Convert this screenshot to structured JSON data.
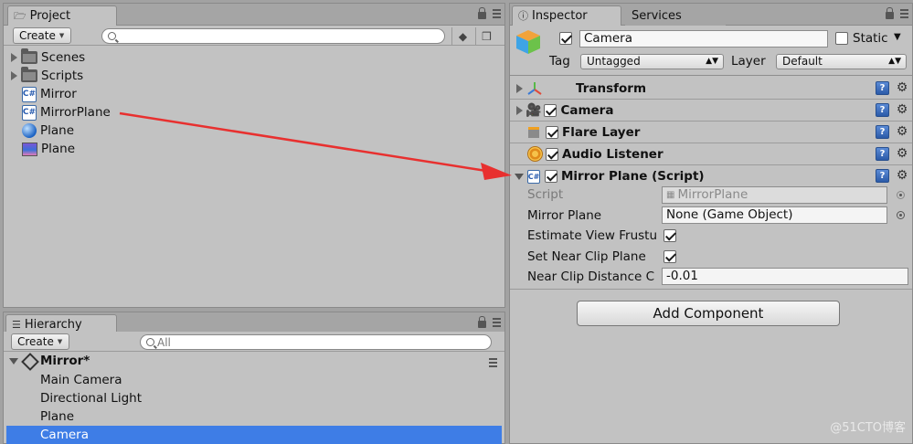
{
  "project": {
    "tab_label": "Project",
    "create_label": "Create",
    "search_placeholder": "",
    "items": [
      {
        "label": "Scenes",
        "type": "folder"
      },
      {
        "label": "Scripts",
        "type": "folder"
      },
      {
        "label": "Mirror",
        "type": "script"
      },
      {
        "label": "MirrorPlane",
        "type": "script"
      },
      {
        "label": "Plane",
        "type": "material"
      },
      {
        "label": "Plane",
        "type": "texture"
      }
    ]
  },
  "hierarchy": {
    "tab_label": "Hierarchy",
    "create_label": "Create",
    "search_placeholder": "All",
    "scene_name": "Mirror*",
    "items": [
      {
        "label": "Main Camera",
        "selected": false
      },
      {
        "label": "Directional Light",
        "selected": false
      },
      {
        "label": "Plane",
        "selected": false
      },
      {
        "label": "Camera",
        "selected": true
      }
    ]
  },
  "inspector": {
    "tab_label": "Inspector",
    "services_tab_label": "Services",
    "object_name": "Camera",
    "static_label": "Static",
    "tag_label": "Tag",
    "tag_value": "Untagged",
    "layer_label": "Layer",
    "layer_value": "Default",
    "components": [
      {
        "name": "Transform",
        "has_checkbox": false
      },
      {
        "name": "Camera",
        "has_checkbox": true
      },
      {
        "name": "Flare Layer",
        "has_checkbox": true
      },
      {
        "name": "Audio Listener",
        "has_checkbox": true
      },
      {
        "name": "Mirror Plane (Script)",
        "has_checkbox": true
      }
    ],
    "script_fields": {
      "script_label": "Script",
      "script_value": "MirrorPlane",
      "mirror_plane_label": "Mirror Plane",
      "mirror_plane_value": "None (Game Object)",
      "estimate_label": "Estimate View Frustu",
      "near_clip_label": "Set Near Clip Plane",
      "near_dist_label": "Near Clip Distance C",
      "near_dist_value": "-0.01"
    },
    "add_component_label": "Add Component"
  },
  "watermark": "@51CTO博客",
  "colors": {
    "selection": "#3e7de6",
    "arrow": "#e8302f",
    "panel_bg": "#c2c2c2"
  }
}
